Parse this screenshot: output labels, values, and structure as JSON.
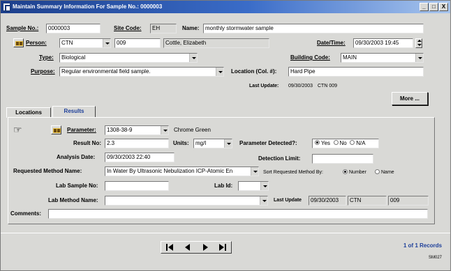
{
  "window": {
    "title": "Maintain Summary Information For Sample No.: 0000003",
    "controls": {
      "minimize": "_",
      "maximize": "□",
      "close": "X"
    }
  },
  "header": {
    "sample_no_label": "Sample No.:",
    "sample_no": "0000003",
    "site_code_label": "Site Code:",
    "site_code": "EH",
    "name_label": "Name:",
    "name": "monthly stormwater sample",
    "person_label": "Person:",
    "person_code": "CTN",
    "person_id": "009",
    "person_name": "Cottle, Elizabeth",
    "datetime_label": "Date/Time:",
    "datetime": "09/30/2003 19:45",
    "type_label": "Type:",
    "type": "Biological",
    "building_code_label": "Building Code:",
    "building_code": "MAIN",
    "purpose_label": "Purpose:",
    "purpose": "Regular environmental field sample.",
    "location_label": "Location (Col. #):",
    "location": "Hard Pipe",
    "last_update_label": "Last Update:",
    "last_update_date": "09/30/2003",
    "last_update_user": "CTN  009",
    "more_button": "More ..."
  },
  "tabs": [
    {
      "label": "Locations",
      "active": false
    },
    {
      "label": "Results",
      "active": true,
      "color": "#1d3f9a"
    }
  ],
  "results": {
    "parameter_label": "Parameter:",
    "parameter": "1308-38-9",
    "parameter_name": "Chrome Green",
    "result_no_label": "Result No:",
    "result_no": "2.3",
    "units_label": "Units:",
    "units": "mg/l",
    "detected_label": "Parameter Detected?:",
    "detected_options": [
      "Yes",
      "No",
      "N/A"
    ],
    "detected_selected": "Yes",
    "analysis_date_label": "Analysis Date:",
    "analysis_date": "09/30/2003 22:40",
    "detection_limit_label": "Detection Limit:",
    "detection_limit": "",
    "method_label": "Requested Method Name:",
    "method": "In Water By Ultrasonic Nebulization ICP-Atomic En",
    "sort_label": "Sort Requested Method By:",
    "sort_options": [
      "Number",
      "Name"
    ],
    "sort_selected": "Number",
    "lab_sample_label": "Lab Sample No:",
    "lab_sample": "",
    "lab_id_label": "Lab Id:",
    "lab_id": "",
    "lab_method_label": "Lab Method Name:",
    "lab_method": "",
    "last_update_label": "Last Update",
    "last_update_date": "09/30/2003",
    "last_update_user": "CTN",
    "last_update_id": "009",
    "comments_label": "Comments:",
    "comments": ""
  },
  "footer": {
    "record_count": "1 of 1 Records",
    "screen_id": "SM027",
    "accent": "#1d3f9a"
  }
}
